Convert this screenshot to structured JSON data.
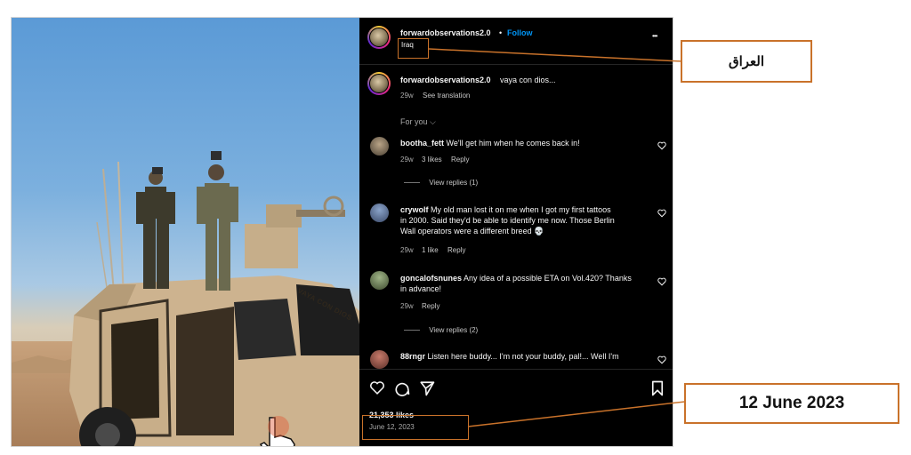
{
  "post": {
    "username": "forwardobservations2.0",
    "separator": "•",
    "follow_label": "Follow",
    "location": "Iraq",
    "more_label": "•••",
    "caption_user": "forwardobservations2.0",
    "caption_text": "vaya con dios...",
    "caption_age": "29w",
    "see_translation": "See translation",
    "for_you": "For you",
    "vehicle_text": "VAYA CON DIOS"
  },
  "comments": [
    {
      "user": "bootha_fett",
      "text": "We'll get him when he comes back in!",
      "age": "29w",
      "likes": "3 likes",
      "reply": "Reply",
      "view_replies": "View replies (1)"
    },
    {
      "user": "crywolf",
      "text_line1": "My old man lost it on me when I got my first tattoos",
      "text_line2": "in 2000. Said they'd be able to identify me now. Those Berlin",
      "text_line3": "Wall operators were a different breed 💀",
      "age": "29w",
      "likes": "1 like",
      "reply": "Reply"
    },
    {
      "user": "goncalofsnunes",
      "text_line1": "Any idea of a possible ETA on Vol.420? Thanks",
      "text_line2": "in advance!",
      "age": "29w",
      "reply": "Reply",
      "view_replies": "View replies (2)"
    },
    {
      "user": "88rngr",
      "text": "Listen here buddy... I'm not your buddy, pal!... Well I'm"
    }
  ],
  "footer": {
    "likes": "21,353 likes",
    "date": "June 12, 2023"
  },
  "annotations": {
    "location_callout": "العراق",
    "date_callout": "12 June 2023",
    "accent_color": "#c9722a"
  }
}
